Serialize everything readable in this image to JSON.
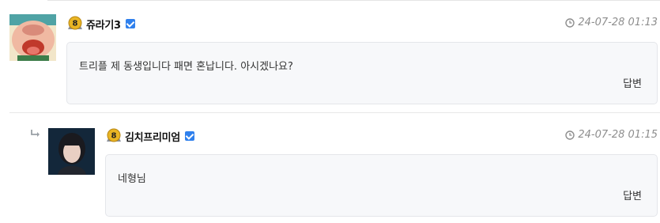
{
  "comments": [
    {
      "level": "8",
      "nickname": "쥬라기3",
      "timestamp": "24-07-28 01:13",
      "text": "트리플 제 동생입니다 패면 혼납니다. 아시겠나요?",
      "reply_label": "답변"
    },
    {
      "level": "8",
      "nickname": "김치프리미엄",
      "timestamp": "24-07-28 01:15",
      "text": "네형님",
      "reply_label": "답변",
      "is_reply": true
    }
  ],
  "icons": {
    "verified": "verified-check-icon",
    "clock": "clock-icon",
    "level_badge": "level-badge-icon",
    "reply_indicator": "reply-arrow-icon"
  },
  "colors": {
    "verified": "#2f80ed",
    "timestamp": "#8e8e8e",
    "bubble_bg": "#f7f8fa",
    "bubble_border": "#e4e6ea",
    "badge_gold": "#e9b524"
  }
}
